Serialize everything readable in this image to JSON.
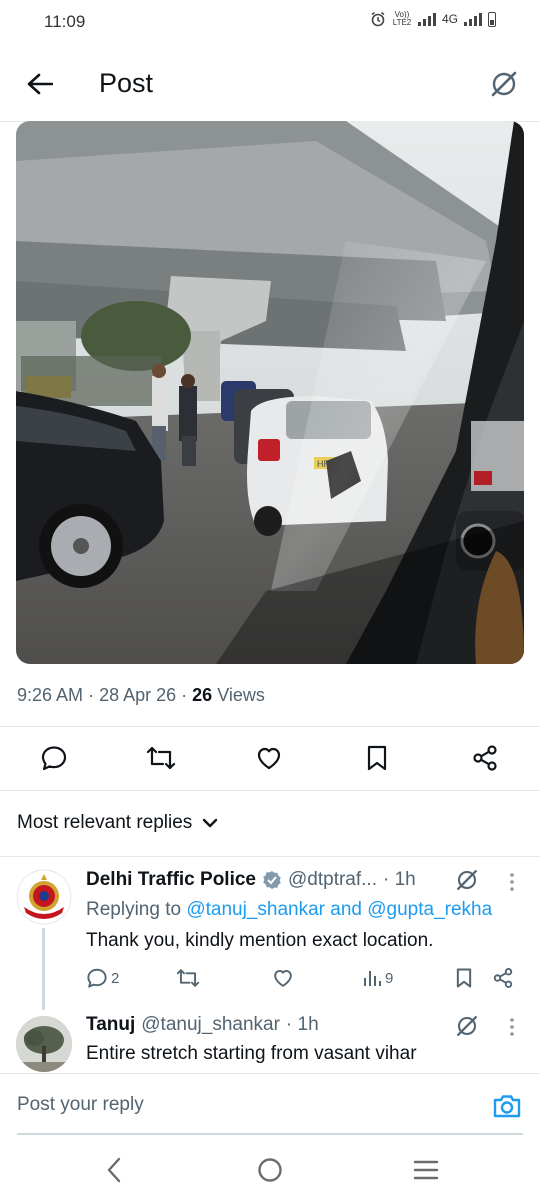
{
  "status_bar": {
    "time": "11:09",
    "volte_label": "Vo)) LTE2",
    "network_label": "4G"
  },
  "header": {
    "title": "Post",
    "back_icon": "arrow-left-icon",
    "grok_icon": "grok-slash-icon"
  },
  "post": {
    "time": "9:26 AM",
    "date": "28 Apr 26",
    "views_count": "26",
    "views_label": "Views",
    "photo_plate_text": "HR"
  },
  "actions": [
    {
      "name": "reply",
      "icon": "comment-icon"
    },
    {
      "name": "repost",
      "icon": "repost-icon"
    },
    {
      "name": "like",
      "icon": "heart-icon"
    },
    {
      "name": "bookmark",
      "icon": "bookmark-icon"
    },
    {
      "name": "share",
      "icon": "share-icon"
    }
  ],
  "replies_section": {
    "label": "Most relevant replies"
  },
  "replies": [
    {
      "name": "Delhi Traffic Police",
      "verified": true,
      "handle": "@dtptraf...",
      "time": "· 1h",
      "replying_prefix": "Replying to",
      "replying_user1": "@tanuj_shankar",
      "replying_and": "and",
      "replying_user2": "@gupta_rekha",
      "text": "Thank you, kindly mention exact location.",
      "reply_count": "2",
      "views_count": "9"
    },
    {
      "name": "Tanuj",
      "handle": "@tanuj_shankar",
      "time": "· 1h",
      "text": "Entire stretch starting from vasant vihar"
    }
  ],
  "composer": {
    "placeholder": "Post your reply"
  },
  "colors": {
    "accent": "#1d9bf0",
    "text_primary": "#0f1419",
    "text_secondary": "#536471",
    "verified": "#829aab"
  }
}
